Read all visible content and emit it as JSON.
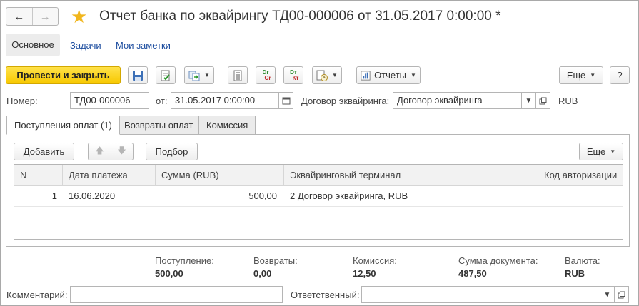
{
  "header": {
    "title": "Отчет банка по эквайрингу ТД00-000006 от 31.05.2017 0:00:00 *",
    "nav_back": "←",
    "nav_forward": "→"
  },
  "sections": {
    "main": "Основное",
    "tasks": "Задачи",
    "notes": "Мои заметки"
  },
  "toolbar": {
    "post_close": "Провести и закрыть",
    "dt_label_top": "Dт",
    "dt_label_bottom": "Кт",
    "dr_label_top": "Dr",
    "dr_label_bottom": "Cr",
    "reports": "Отчеты",
    "more": "Еще",
    "help": "?"
  },
  "form": {
    "number_label": "Номер:",
    "number_value": "ТД00-000006",
    "date_label": "от:",
    "date_value": "31.05.2017  0:00:00",
    "contract_label": "Договор эквайринга:",
    "contract_value": "Договор эквайринга",
    "currency": "RUB"
  },
  "tabs": [
    {
      "label": "Поступления оплат (1)"
    },
    {
      "label": "Возвраты оплат"
    },
    {
      "label": "Комиссия"
    }
  ],
  "table_toolbar": {
    "add": "Добавить",
    "pick": "Подбор",
    "more": "Еще"
  },
  "table": {
    "columns": [
      "N",
      "Дата платежа",
      "Сумма (RUB)",
      "Эквайринговый терминал",
      "Код авторизации"
    ],
    "rows": [
      {
        "n": "1",
        "date": "16.06.2020",
        "sum": "500,00",
        "terminal": "2 Договор эквайринга, RUB",
        "auth": ""
      }
    ]
  },
  "totals": {
    "receipt_label": "Поступление:",
    "receipt_value": "500,00",
    "returns_label": "Возвраты:",
    "returns_value": "0,00",
    "commission_label": "Комиссия:",
    "commission_value": "12,50",
    "doc_sum_label": "Сумма документа:",
    "doc_sum_value": "487,50",
    "currency_label": "Валюта:",
    "currency_value": "RUB"
  },
  "footer": {
    "comment_label": "Комментарий:",
    "comment_value": "",
    "responsible_label": "Ответственный:",
    "responsible_value": ""
  },
  "colors": {
    "primary": "#f7c800",
    "link": "#1f4fa0",
    "star": "#f1b61d"
  }
}
